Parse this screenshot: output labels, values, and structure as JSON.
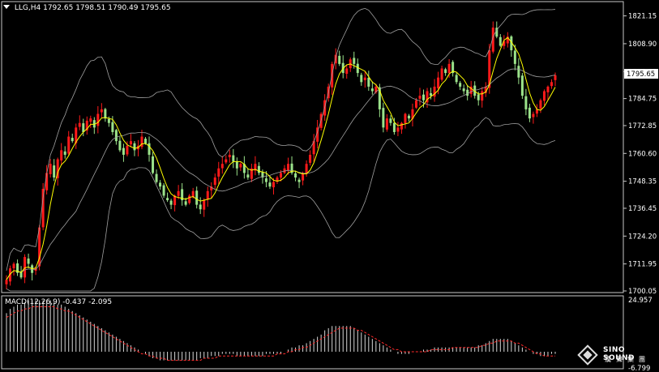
{
  "header": {
    "symbol": "LLG,H4",
    "ohlc": "1792.65 1798.51 1790.49 1795.65"
  },
  "macd": {
    "label": "MACD(12,26,9) -0.437 -2.095",
    "axis_top": "24.957",
    "axis_bottom": "-6.799"
  },
  "logo": {
    "text_en": "SINO SOUND",
    "text_cn": "漢聲集團"
  },
  "colors": {
    "background": "#000000",
    "bull": "#e0e0e0",
    "bull_candle": "#ff1a1a",
    "bear_candle": "#9be28a",
    "ma": "#ffff00",
    "bands": "#a0a0a0",
    "macd_hist": "#d8d8d8",
    "macd_signal": "#ff2a2a",
    "current_price_box": "#ffffff"
  },
  "chart_data": {
    "type": "candlestick",
    "price_axis": {
      "ticks": [
        "1821.15",
        "1808.90",
        "1796.65",
        "1784.75",
        "1772.85",
        "1760.60",
        "1748.35",
        "1736.45",
        "1724.20",
        "1711.95",
        "1700.05"
      ],
      "range": [
        1700.05,
        1826
      ],
      "current_price": "1795.65"
    },
    "closes": [
      1705,
      1710,
      1712,
      1708,
      1706,
      1715,
      1712,
      1708,
      1710,
      1728,
      1745,
      1752,
      1756,
      1750,
      1758,
      1762,
      1760,
      1768,
      1766,
      1772,
      1774,
      1770,
      1775,
      1776,
      1772,
      1778,
      1780,
      1776,
      1774,
      1770,
      1766,
      1762,
      1760,
      1764,
      1766,
      1762,
      1764,
      1768,
      1765,
      1760,
      1752,
      1748,
      1746,
      1742,
      1740,
      1738,
      1742,
      1744,
      1740,
      1738,
      1742,
      1744,
      1738,
      1736,
      1740,
      1744,
      1746,
      1750,
      1754,
      1756,
      1758,
      1760,
      1757,
      1754,
      1756,
      1752,
      1750,
      1754,
      1756,
      1752,
      1750,
      1748,
      1746,
      1748,
      1750,
      1752,
      1754,
      1756,
      1752,
      1750,
      1748,
      1752,
      1756,
      1760,
      1766,
      1772,
      1778,
      1784,
      1790,
      1800,
      1804,
      1800,
      1796,
      1798,
      1802,
      1800,
      1796,
      1792,
      1794,
      1790,
      1788,
      1790,
      1780,
      1772,
      1776,
      1774,
      1770,
      1772,
      1774,
      1778,
      1776,
      1780,
      1784,
      1786,
      1784,
      1788,
      1786,
      1790,
      1794,
      1798,
      1796,
      1800,
      1796,
      1792,
      1790,
      1788,
      1786,
      1790,
      1786,
      1784,
      1788,
      1790,
      1806,
      1816,
      1812,
      1808,
      1810,
      1812,
      1806,
      1800,
      1794,
      1786,
      1780,
      1776,
      1778,
      1780,
      1784,
      1788,
      1790,
      1792,
      1795
    ],
    "macd_histogram": [
      18,
      20,
      21,
      22,
      22,
      23,
      24,
      24,
      24,
      24,
      24,
      24,
      24,
      23,
      22,
      22,
      21,
      20,
      19,
      18,
      17,
      16,
      15,
      14,
      13,
      12,
      11,
      10,
      9,
      8,
      7,
      6,
      5,
      4,
      3,
      2,
      1,
      0,
      -1,
      -2,
      -3,
      -3,
      -4,
      -4,
      -4,
      -4,
      -4,
      -4,
      -4,
      -4,
      -4,
      -4,
      -4,
      -3,
      -3,
      -3,
      -2,
      -2,
      -2,
      -1,
      -1,
      -1,
      -1,
      -2,
      -2,
      -2,
      -2,
      -2,
      -2,
      -2,
      -2,
      -1,
      -1,
      -1,
      -1,
      -1,
      0,
      1,
      2,
      2,
      3,
      3,
      4,
      5,
      6,
      7,
      8,
      10,
      11,
      12,
      12,
      12,
      12,
      12,
      12,
      11,
      10,
      9,
      8,
      7,
      6,
      5,
      4,
      3,
      2,
      1,
      0,
      -1,
      -1,
      -1,
      -1,
      0,
      0,
      0,
      1,
      1,
      1,
      2,
      2,
      2,
      2,
      2,
      2,
      2,
      2,
      2,
      2,
      2,
      2,
      3,
      3,
      4,
      5,
      6,
      6,
      6,
      6,
      6,
      5,
      4,
      3,
      2,
      1,
      0,
      -1,
      -1,
      -2,
      -2,
      -2,
      -1,
      -1
    ],
    "macd_signal": [
      16,
      17,
      18,
      19,
      19,
      20,
      20,
      21,
      21,
      21,
      21,
      21,
      21,
      21,
      20,
      20,
      19,
      19,
      18,
      17,
      16,
      15,
      14,
      13,
      12,
      11,
      10,
      9,
      8,
      7,
      6,
      5,
      4,
      3,
      2,
      1,
      0,
      -1,
      -1,
      -2,
      -2,
      -3,
      -3,
      -3,
      -4,
      -4,
      -4,
      -4,
      -4,
      -4,
      -4,
      -4,
      -4,
      -4,
      -3,
      -3,
      -3,
      -3,
      -2,
      -2,
      -2,
      -2,
      -2,
      -2,
      -2,
      -2,
      -2,
      -2,
      -2,
      -2,
      -2,
      -2,
      -2,
      -2,
      -1,
      -1,
      -1,
      0,
      0,
      1,
      1,
      2,
      2,
      3,
      4,
      5,
      6,
      7,
      8,
      9,
      10,
      11,
      11,
      11,
      11,
      11,
      10,
      10,
      9,
      8,
      7,
      6,
      5,
      4,
      3,
      2,
      1,
      1,
      0,
      0,
      0,
      0,
      0,
      0,
      0,
      0,
      1,
      1,
      1,
      1,
      1,
      1,
      2,
      2,
      2,
      2,
      2,
      2,
      2,
      2,
      3,
      3,
      4,
      4,
      5,
      5,
      5,
      5,
      5,
      4,
      4,
      3,
      2,
      1,
      0,
      -1,
      -1,
      -2,
      -2,
      -2,
      -2
    ]
  }
}
